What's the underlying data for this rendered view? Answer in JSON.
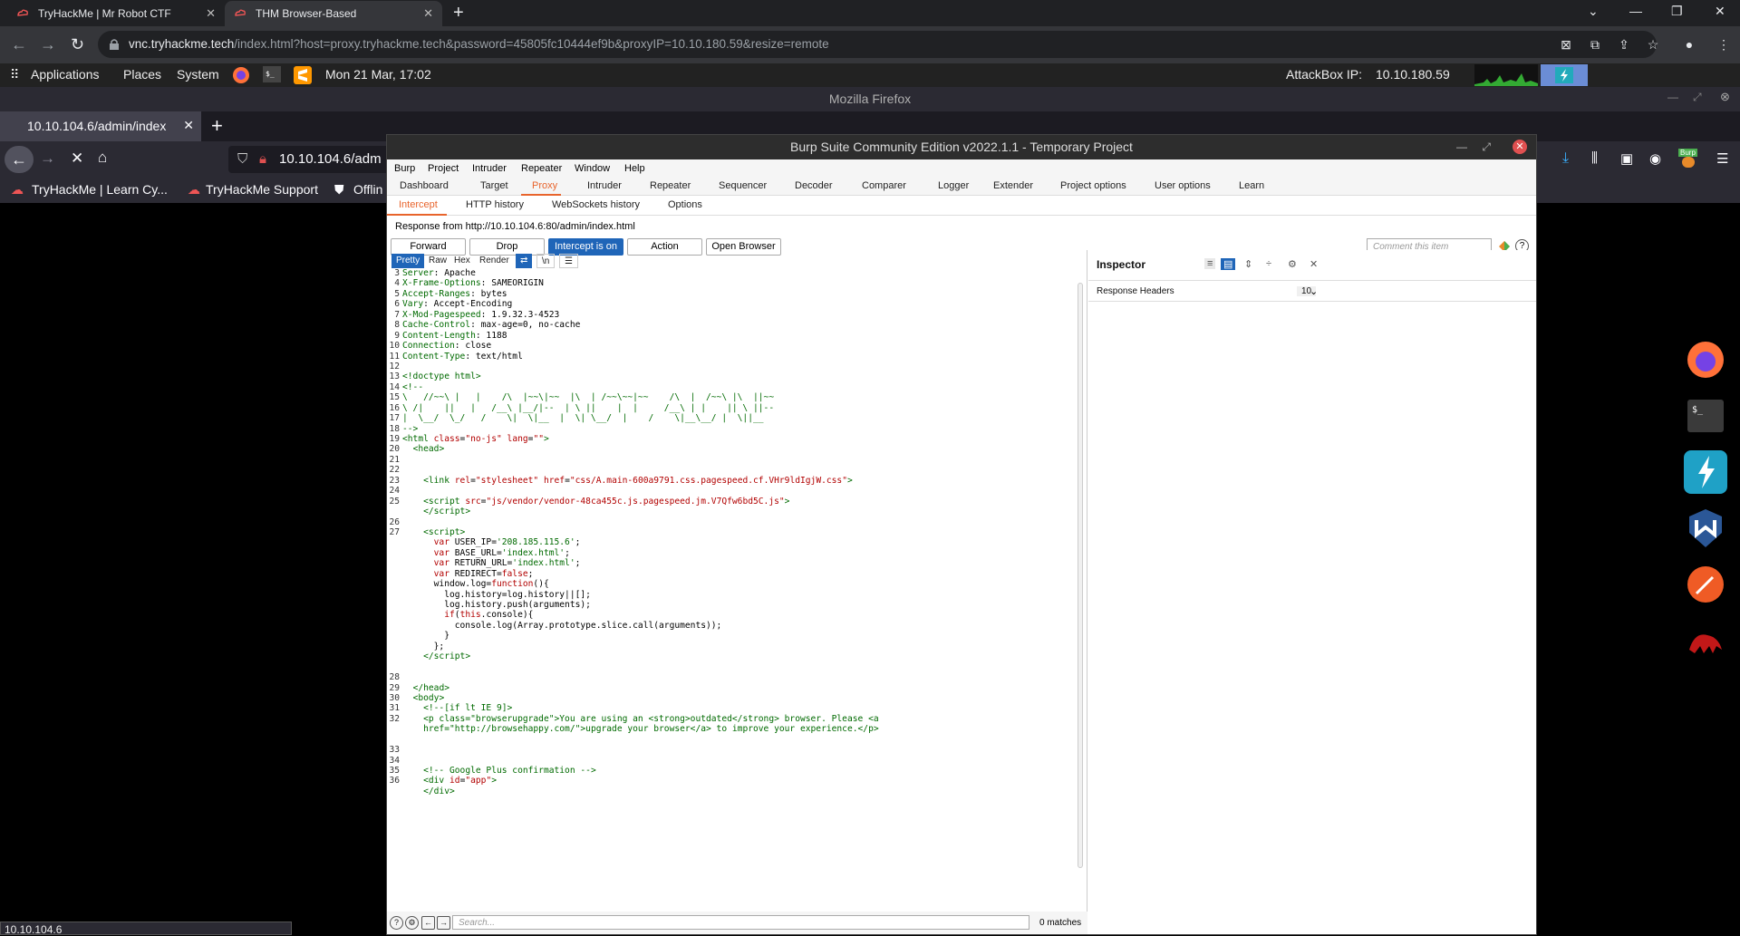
{
  "chrome": {
    "tabs": [
      {
        "title": "TryHackMe | Mr Robot CTF"
      },
      {
        "title": "THM Browser-Based"
      }
    ],
    "url_host": "vnc.tryhackme.tech",
    "url_rest": "/index.html?host=proxy.tryhackme.tech&password=45805fc10444ef9b&proxyIP=10.10.180.59&resize=remote"
  },
  "panel": {
    "applications": "Applications",
    "places": "Places",
    "system": "System",
    "datetime": "Mon 21 Mar, 17:02",
    "attackbox_label": "AttackBox IP:",
    "attackbox_ip": "10.10.180.59"
  },
  "firefox": {
    "window_title": "Mozilla Firefox",
    "tab_title": "10.10.104.6/admin/index",
    "url": "10.10.104.6/adm",
    "bookmarks": [
      "TryHackMe | Learn Cy...",
      "TryHackMe Support",
      "Offlin"
    ],
    "status": "10.10.104.6",
    "burp_badge": "Burp"
  },
  "burp": {
    "title": "Burp Suite Community Edition v2022.1.1 - Temporary Project",
    "menu": [
      "Burp",
      "Project",
      "Intruder",
      "Repeater",
      "Window",
      "Help"
    ],
    "main_tabs": [
      "Dashboard",
      "Target",
      "Proxy",
      "Intruder",
      "Repeater",
      "Sequencer",
      "Decoder",
      "Comparer",
      "Logger",
      "Extender",
      "Project options",
      "User options",
      "Learn"
    ],
    "sub_tabs": [
      "Intercept",
      "HTTP history",
      "WebSockets history",
      "Options"
    ],
    "response_from": "Response from http://10.10.104.6:80/admin/index.html",
    "buttons": {
      "forward": "Forward",
      "drop": "Drop",
      "intercept": "Intercept is on",
      "action": "Action",
      "open_browser": "Open Browser"
    },
    "comment_placeholder": "Comment this item",
    "editor_tools": [
      "Pretty",
      "Raw",
      "Hex",
      "Render",
      "\\n"
    ],
    "search_placeholder": "Search...",
    "matches": "0 matches",
    "inspector": {
      "title": "Inspector",
      "response_headers": "Response Headers",
      "count": "10"
    },
    "code_lines": [
      {
        "n": "3",
        "html": "<span class='k'>Server</span>: Apache"
      },
      {
        "n": "4",
        "html": "<span class='k'>X-Frame-Options</span>: SAMEORIGIN"
      },
      {
        "n": "5",
        "html": "<span class='k'>Accept-Ranges</span>: bytes"
      },
      {
        "n": "6",
        "html": "<span class='k'>Vary</span>: Accept-Encoding"
      },
      {
        "n": "7",
        "html": "<span class='k'>X-Mod-Pagespeed</span>: 1.9.32.3-4523"
      },
      {
        "n": "8",
        "html": "<span class='k'>Cache-Control</span>: max-age=0, no-cache"
      },
      {
        "n": "9",
        "html": "<span class='k'>Content-Length</span>: 1188"
      },
      {
        "n": "10",
        "html": "<span class='k'>Connection</span>: close"
      },
      {
        "n": "11",
        "html": "<span class='k'>Content-Type</span>: text/html"
      },
      {
        "n": "12",
        "html": ""
      },
      {
        "n": "13",
        "html": "<span class='t'>&lt;!doctype html&gt;</span>"
      },
      {
        "n": "14",
        "html": "<span class='t'>&lt;!--</span>"
      },
      {
        "n": "15",
        "html": "<span class='t'>\\   //~~\\ |   |    /\\  |~~\\|~~  |\\  | /~~\\~~|~~    /\\  |  /~~\\ |\\  ||~~</span>"
      },
      {
        "n": "16",
        "html": "<span class='t'>\\ /|    ||   |   /__\\ |__/|--  | \\ ||    |  |     /__\\ | |    || \\ ||--</span>"
      },
      {
        "n": "17",
        "html": "<span class='t'>|  \\__/  \\_/   /    \\|  \\|__  |  \\| \\__/  |    /    \\|__\\__/ |  \\||__</span>"
      },
      {
        "n": "18",
        "html": "<span class='t'>--&gt;</span>"
      },
      {
        "n": "19",
        "html": "<span class='t'>&lt;html </span><span class='v'>class</span>=<span class='v'>\"no-js\"</span> <span class='v'>lang</span>=<span class='v'>\"\"</span><span class='t'>&gt;</span>"
      },
      {
        "n": "20",
        "html": "  <span class='t'>&lt;head&gt;</span>"
      },
      {
        "n": "21",
        "html": ""
      },
      {
        "n": "22",
        "html": ""
      },
      {
        "n": "23",
        "html": "    <span class='t'>&lt;link </span><span class='v'>rel</span>=<span class='v'>\"stylesheet\"</span> <span class='v'>href</span>=<span class='v'>\"css/A.main-600a9791.css.pagespeed.cf.VHr9ldIgjW.css\"</span><span class='t'>&gt;</span>"
      },
      {
        "n": "24",
        "html": ""
      },
      {
        "n": "25",
        "html": "    <span class='t'>&lt;script </span><span class='v'>src</span>=<span class='v'>\"js/vendor/vendor-48ca455c.js.pagespeed.jm.V7Qfw6bd5C.js\"</span><span class='t'>&gt;</span>"
      },
      {
        "n": "",
        "html": "    <span class='t'>&lt;/script&gt;</span>"
      },
      {
        "n": "26",
        "html": ""
      },
      {
        "n": "27",
        "html": "    <span class='t'>&lt;script&gt;</span>"
      },
      {
        "n": "",
        "html": "      <span class='v'>var</span> USER_IP=<span class='k'>'208.185.115.6'</span>;"
      },
      {
        "n": "",
        "html": "      <span class='v'>var</span> BASE_URL=<span class='k'>'index.html'</span>;"
      },
      {
        "n": "",
        "html": "      <span class='v'>var</span> RETURN_URL=<span class='k'>'index.html'</span>;"
      },
      {
        "n": "",
        "html": "      <span class='v'>var</span> REDIRECT=<span class='v'>false</span>;"
      },
      {
        "n": "",
        "html": "      window.log=<span class='v'>function</span>(){"
      },
      {
        "n": "",
        "html": "        log.history=log.history||[];"
      },
      {
        "n": "",
        "html": "        log.history.push(arguments);"
      },
      {
        "n": "",
        "html": "        <span class='v'>if</span>(<span class='v'>this</span>.console){"
      },
      {
        "n": "",
        "html": "          console.log(Array.prototype.slice.call(arguments));"
      },
      {
        "n": "",
        "html": "        }"
      },
      {
        "n": "",
        "html": "      };"
      },
      {
        "n": "",
        "html": "    <span class='t'>&lt;/script&gt;</span>"
      },
      {
        "n": "",
        "html": ""
      },
      {
        "n": "28",
        "html": ""
      },
      {
        "n": "29",
        "html": "  <span class='t'>&lt;/head&gt;</span>"
      },
      {
        "n": "30",
        "html": "  <span class='t'>&lt;body&gt;</span>"
      },
      {
        "n": "31",
        "html": "    <span class='t'>&lt;!--[if lt IE 9]&gt;</span>"
      },
      {
        "n": "32",
        "html": "    <span class='t'>&lt;p class=\"browserupgrade\"&gt;You are using an &lt;strong&gt;outdated&lt;/strong&gt; browser. Please &lt;a</span>"
      },
      {
        "n": "",
        "html": "    <span class='t'>href=\"http://browsehappy.com/\"&gt;upgrade your browser&lt;/a&gt; to improve your experience.&lt;/p&gt;</span>"
      },
      {
        "n": "",
        "html": ""
      },
      {
        "n": "33",
        "html": ""
      },
      {
        "n": "34",
        "html": ""
      },
      {
        "n": "35",
        "html": "    <span class='t'>&lt;!-- Google Plus confirmation --&gt;</span>"
      },
      {
        "n": "36",
        "html": "    <span class='t'>&lt;div </span><span class='v'>id</span>=<span class='v'>\"app\"</span><span class='t'>&gt;</span>"
      },
      {
        "n": "",
        "html": "    <span class='t'>&lt;/div&gt;</span>"
      }
    ]
  }
}
